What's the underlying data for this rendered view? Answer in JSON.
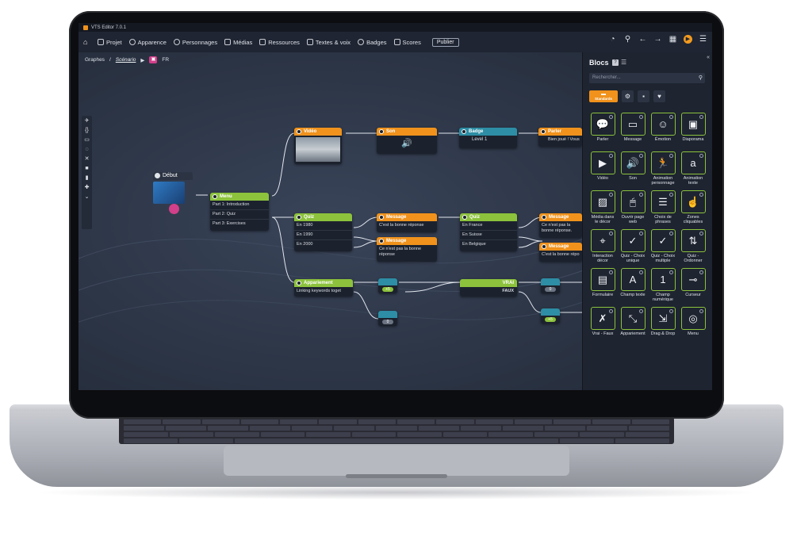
{
  "app": {
    "title": "VTS Editor 7.0.1",
    "menu": [
      {
        "label": "Projet",
        "icon": "wrench-icon"
      },
      {
        "label": "Apparence",
        "icon": "palette-icon"
      },
      {
        "label": "Personnages",
        "icon": "person-icon"
      },
      {
        "label": "Médias",
        "icon": "media-icon"
      },
      {
        "label": "Ressources",
        "icon": "briefcase-icon"
      },
      {
        "label": "Textes & voix",
        "icon": "text-icon"
      },
      {
        "label": "Badges",
        "icon": "badge-icon"
      },
      {
        "label": "Scores",
        "icon": "chart-icon"
      }
    ],
    "publish_label": "Publier"
  },
  "breadcrumb": {
    "root": "Graphes",
    "current": "Scénario",
    "lang": "FR"
  },
  "graph": {
    "start": {
      "label": "Début"
    },
    "menu": {
      "title": "Menu",
      "items": [
        "Part 1: Introduction",
        "Part 2: Quiz",
        "Part 3: Exercises"
      ]
    },
    "video": {
      "title": "Vidéo"
    },
    "son": {
      "title": "Son"
    },
    "badge": {
      "title": "Badge",
      "value": "Level 1"
    },
    "parler": {
      "title": "Parler",
      "text": "Bien joué ! Vous"
    },
    "quiz1": {
      "title": "Quiz",
      "options": [
        "En 1980",
        "En 1990",
        "En 2000"
      ]
    },
    "msg1": {
      "title": "Message",
      "text": "C'est la bonne réponse"
    },
    "msg2": {
      "title": "Message",
      "text": "Ce n'est pas la bonne réponse"
    },
    "quiz2": {
      "title": "Quiz",
      "options": [
        "En France",
        "En Suisse",
        "En Belgique"
      ]
    },
    "msg3": {
      "title": "Message",
      "text": "Ce n'est pas la bonne réponse."
    },
    "msg4": {
      "title": "Message",
      "text": "C'est la bonne répo"
    },
    "appariement": {
      "title": "Appariement",
      "text": "Linking keywords toget"
    },
    "vraifaux": {
      "true_label": "VRAI",
      "false_label": "FAUX"
    },
    "scores": [
      "+5",
      "0",
      "0",
      "+5"
    ]
  },
  "panel": {
    "title": "Blocs",
    "help": "?",
    "search_placeholder": "Rechercher...",
    "category_active": "Standards",
    "blocks": [
      {
        "label": "Parler",
        "icon": "💬"
      },
      {
        "label": "Message",
        "icon": "▭"
      },
      {
        "label": "Émotion",
        "icon": "☺"
      },
      {
        "label": "Diaporama",
        "icon": "▣"
      },
      {
        "label": "Vidéo",
        "icon": "▶"
      },
      {
        "label": "Son",
        "icon": "🔊"
      },
      {
        "label": "Animation personnage",
        "icon": "🏃"
      },
      {
        "label": "Animation texte",
        "icon": "a"
      },
      {
        "label": "Média dans le décor",
        "icon": "▨"
      },
      {
        "label": "Ouvrir page web",
        "icon": "🖱"
      },
      {
        "label": "Choix de phrases",
        "icon": "☰"
      },
      {
        "label": "Zones cliquables",
        "icon": "☝"
      },
      {
        "label": "Interaction décor",
        "icon": "⌖"
      },
      {
        "label": "Quiz - Choix unique",
        "icon": "✓"
      },
      {
        "label": "Quiz - Choix multiple",
        "icon": "✓"
      },
      {
        "label": "Quiz - Ordonner",
        "icon": "⇅"
      },
      {
        "label": "Formulaire",
        "icon": "▤"
      },
      {
        "label": "Champ texte",
        "icon": "A"
      },
      {
        "label": "Champ numérique",
        "icon": "1"
      },
      {
        "label": "Curseur",
        "icon": "⊸"
      },
      {
        "label": "Vrai - Faux",
        "icon": "✗"
      },
      {
        "label": "Appariement",
        "icon": "⤡"
      },
      {
        "label": "Drag & Drop",
        "icon": "⇲"
      },
      {
        "label": "Menu",
        "icon": "◎"
      }
    ]
  }
}
